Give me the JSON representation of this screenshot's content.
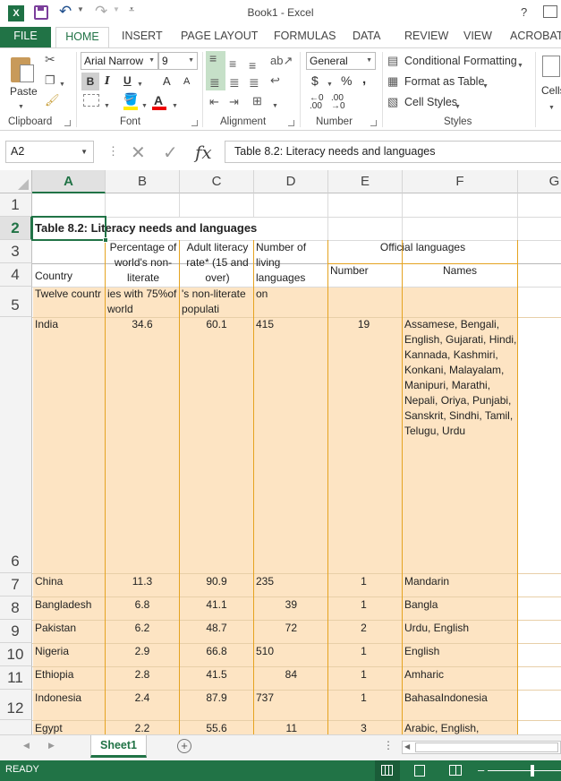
{
  "window": {
    "title": "Book1 - Excel",
    "help": "?"
  },
  "qat": {
    "app_icon_label": "X"
  },
  "tabs": [
    "FILE",
    "HOME",
    "INSERT",
    "PAGE LAYOUT",
    "FORMULAS",
    "DATA",
    "REVIEW",
    "VIEW",
    "ACROBAT"
  ],
  "ribbon": {
    "clipboard": {
      "label": "Clipboard",
      "paste": "Paste"
    },
    "font": {
      "label": "Font",
      "name": "Arial Narrow",
      "size": "9",
      "bold": "B",
      "italic": "I",
      "underline": "U",
      "grow": "A",
      "shrink": "A"
    },
    "alignment": {
      "label": "Alignment"
    },
    "number": {
      "label": "Number",
      "format": "General",
      "currency": "$",
      "percent": "%",
      "comma": ","
    },
    "styles": {
      "label": "Styles",
      "conditional": "Conditional Formatting",
      "format_table": "Format as Table",
      "cell_styles": "Cell Styles"
    },
    "cells": {
      "label": "Cells"
    }
  },
  "formula_bar": {
    "name_box": "A2",
    "fx": "fx",
    "content": "Table 8.2: Literacy needs and languages"
  },
  "columns": [
    "A",
    "B",
    "C",
    "D",
    "E",
    "F",
    "G"
  ],
  "rows": [
    "1",
    "2",
    "3",
    "4",
    "5",
    "6",
    "7",
    "8",
    "9",
    "10",
    "11",
    "12"
  ],
  "sheet": {
    "title": "Table 8.2: Literacy needs and languages",
    "headers": {
      "country": "Country",
      "pct_nonliterate": "Percentage of world's non-literate",
      "adult_literacy": "Adult literacy rate* (15 and over)",
      "num_languages": "Number of living languages",
      "official_languages": "Official languages",
      "number": "Number",
      "names": "Names"
    },
    "row5": {
      "a": "Twelve countr",
      "b": "ies with 75%of world",
      "c": "'s non-literate populati",
      "d": "on"
    },
    "data": [
      {
        "country": "India",
        "pct": "34.6",
        "lit": "60.1",
        "langs": "415",
        "num": "19",
        "names": "Assamese, Bengali, English, Gujarati, Hindi, Kannada, Kashmiri, Konkani, Malayalam, Manipuri, Marathi, Nepali, Oriya, Punjabi, Sanskrit, Sindhi, Tamil, Telugu, Urdu"
      },
      {
        "country": "China",
        "pct": "11.3",
        "lit": "90.9",
        "langs": "235",
        "num": "1",
        "names": "Mandarin"
      },
      {
        "country": "Bangladesh",
        "pct": "6.8",
        "lit": "41.1",
        "langs": "39",
        "num": "1",
        "names": "Bangla"
      },
      {
        "country": "Pakistan",
        "pct": "6.2",
        "lit": "48.7",
        "langs": "72",
        "num": "2",
        "names": "Urdu, English"
      },
      {
        "country": "Nigeria",
        "pct": "2.9",
        "lit": "66.8",
        "langs": "510",
        "num": "1",
        "names": "English"
      },
      {
        "country": "Ethiopia",
        "pct": "2.8",
        "lit": "41.5",
        "langs": "84",
        "num": "1",
        "names": "Amharic"
      },
      {
        "country": "Indonesia",
        "pct": "2.4",
        "lit": "87.9",
        "langs": "737",
        "num": "1",
        "names": "BahasaIndonesia"
      },
      {
        "country": "Egypt",
        "pct": "2.2",
        "lit": "55.6",
        "langs": "11",
        "num": "3",
        "names": "Arabic, English,"
      }
    ]
  },
  "sheet_tabs": {
    "active": "Sheet1"
  },
  "status": {
    "ready": "READY"
  }
}
